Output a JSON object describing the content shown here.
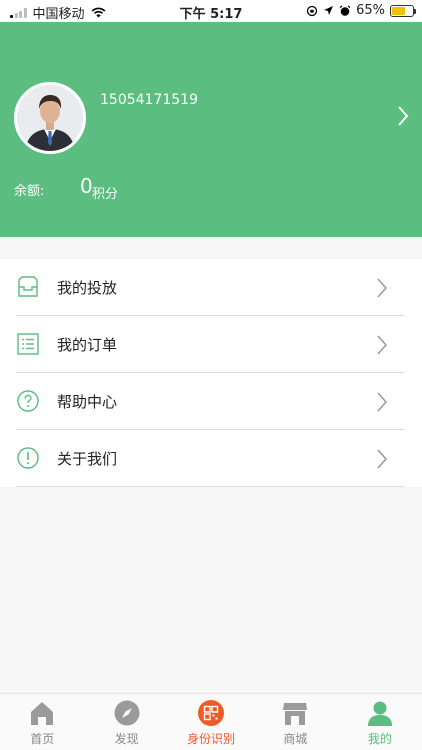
{
  "status_bar": {
    "carrier": "中国移动",
    "time": "下午 5:17",
    "battery_percent": "65%",
    "battery_level": 0.65
  },
  "profile": {
    "phone": "15054171519",
    "balance_label": "余额:",
    "balance_value": "0",
    "balance_unit": "积分"
  },
  "menu": {
    "items": [
      {
        "label": "我的投放",
        "icon": "tray-icon"
      },
      {
        "label": "我的订单",
        "icon": "list-icon"
      },
      {
        "label": "帮助中心",
        "icon": "question-icon"
      },
      {
        "label": "关于我们",
        "icon": "info-icon"
      }
    ]
  },
  "tab_bar": {
    "tabs": [
      {
        "label": "首页",
        "icon": "home-icon"
      },
      {
        "label": "发现",
        "icon": "compass-icon"
      },
      {
        "label": "身份识别",
        "icon": "qr-scan-icon"
      },
      {
        "label": "商城",
        "icon": "store-icon"
      },
      {
        "label": "我的",
        "icon": "person-icon"
      }
    ]
  },
  "colors": {
    "primary_green": "#5bbd7f",
    "accent_orange": "#f05a28",
    "tab_inactive": "#888888"
  }
}
